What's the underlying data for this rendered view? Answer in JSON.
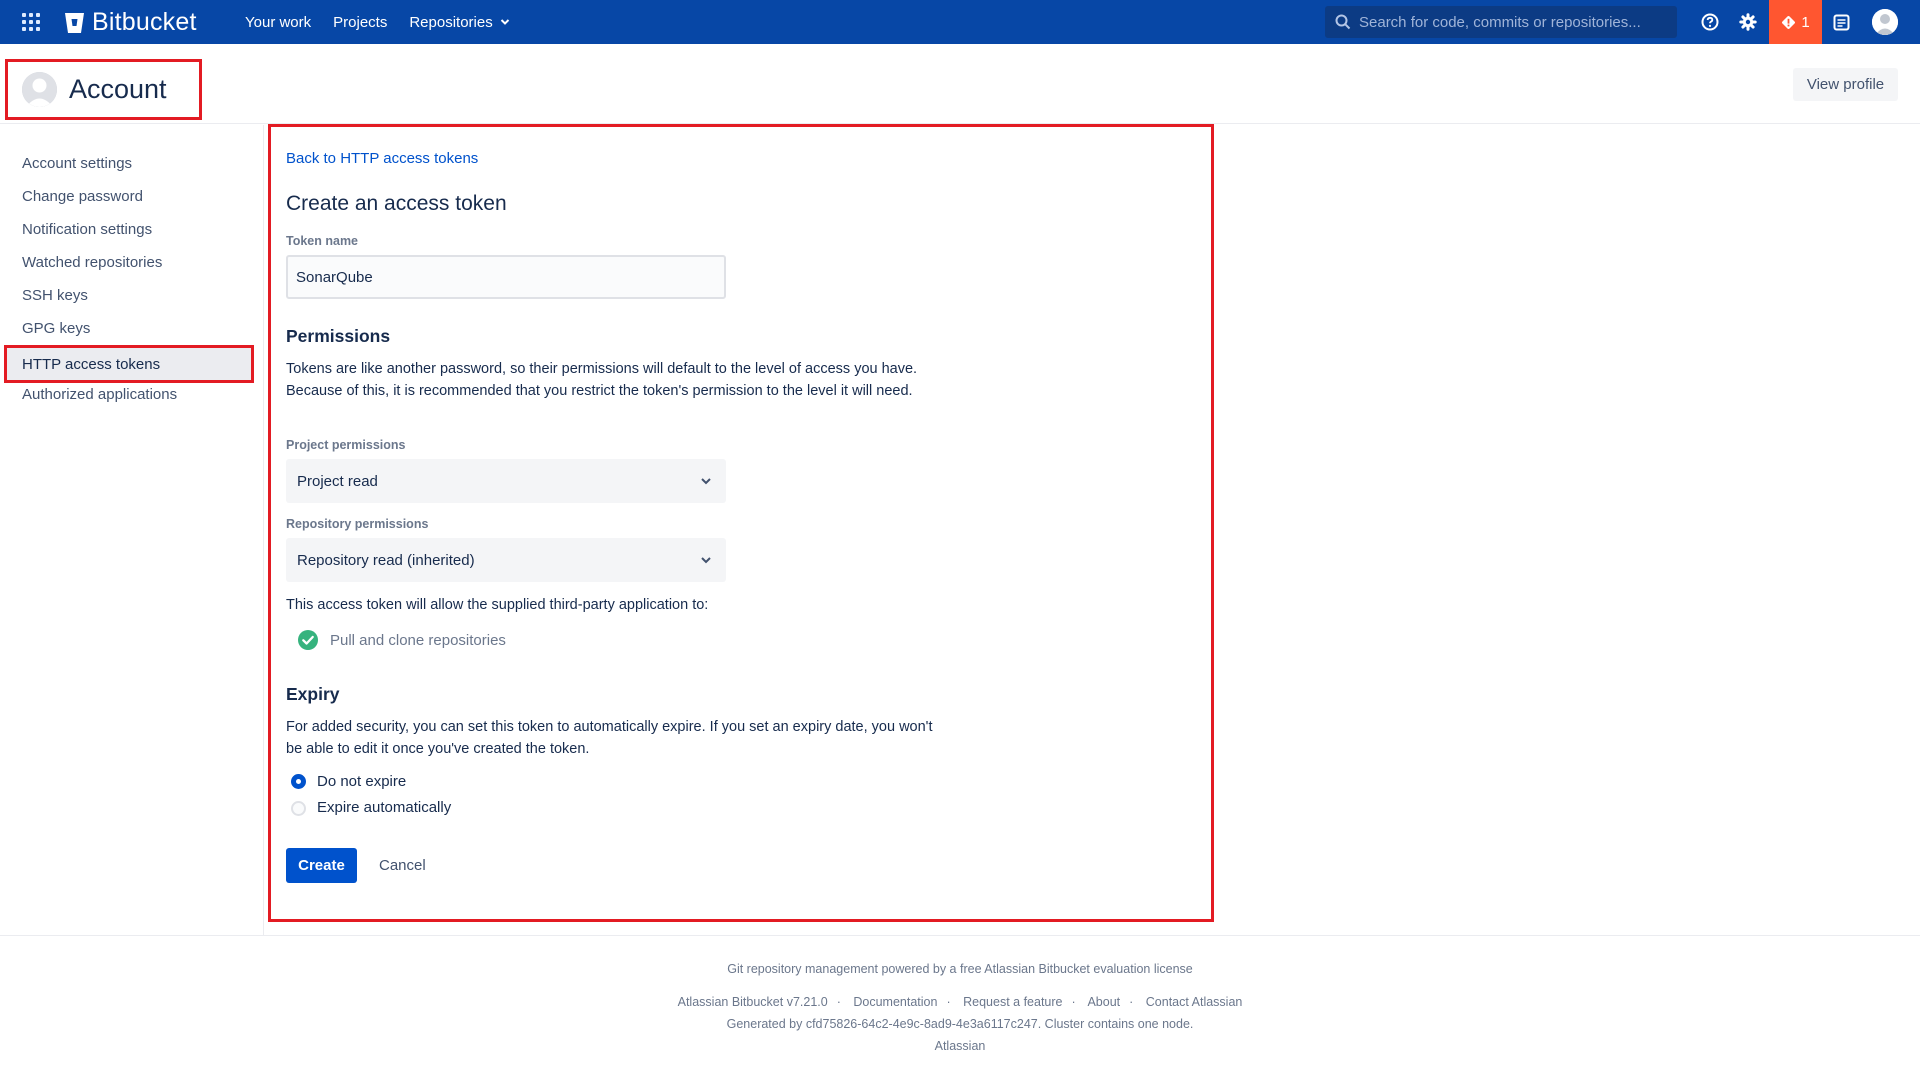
{
  "topnav": {
    "brand": "Bitbucket",
    "links": [
      {
        "label": "Your work"
      },
      {
        "label": "Projects"
      },
      {
        "label": "Repositories"
      }
    ],
    "search_placeholder": "Search for code, commits or repositories...",
    "alerts_count": "1"
  },
  "header": {
    "title": "Account",
    "view_profile": "View profile"
  },
  "sidebar": {
    "items": [
      {
        "label": "Account settings"
      },
      {
        "label": "Change password"
      },
      {
        "label": "Notification settings"
      },
      {
        "label": "Watched repositories"
      },
      {
        "label": "SSH keys"
      },
      {
        "label": "GPG keys"
      },
      {
        "label": "HTTP access tokens"
      },
      {
        "label": "Authorized applications"
      }
    ]
  },
  "form": {
    "back_link": "Back to HTTP access tokens",
    "title": "Create an access token",
    "token_name_label": "Token name",
    "token_name_value": "SonarQube",
    "permissions_heading": "Permissions",
    "permissions_text": "Tokens are like another password, so their permissions will default to the level of access you have. Because of this, it is recommended that you restrict the token's permission to the level it will need.",
    "project_perm_label": "Project permissions",
    "project_perm_value": "Project read",
    "repo_perm_label": "Repository permissions",
    "repo_perm_value": "Repository read (inherited)",
    "allow_text": "This access token will allow the supplied third-party application to:",
    "allow_item": "Pull and clone repositories",
    "expiry_heading": "Expiry",
    "expiry_text": "For added security, you can set this token to automatically expire. If you set an expiry date, you won't be able to edit it once you've created the token.",
    "radio_no_expire": "Do not expire",
    "radio_expire_auto": "Expire automatically",
    "create_button": "Create",
    "cancel_button": "Cancel"
  },
  "footer": {
    "license": "Git repository management powered by a free Atlassian Bitbucket evaluation license",
    "links": [
      "Atlassian Bitbucket v7.21.0",
      "Documentation",
      "Request a feature",
      "About",
      "Contact Atlassian"
    ],
    "generated": "Generated by cfd75826-64c2-4e9c-8ad9-4e3a6117c247. Cluster contains one node.",
    "company": "Atlassian"
  },
  "colors": {
    "nav_bg": "#0747a6",
    "primary": "#0052cc",
    "alert": "#ff5630",
    "highlight_border": "#e31b23",
    "success": "#36b37e"
  }
}
